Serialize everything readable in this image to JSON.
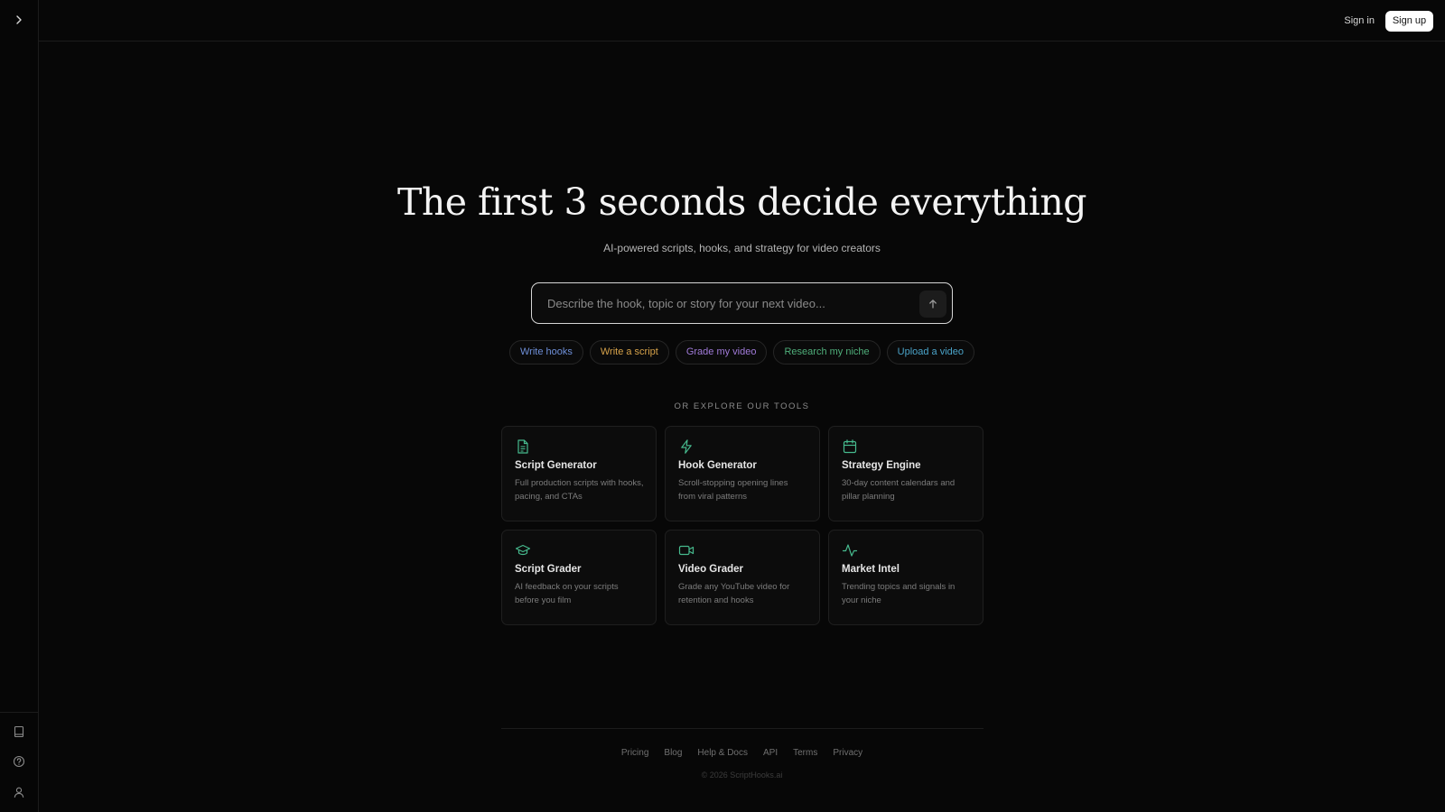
{
  "header": {
    "sign_in": "Sign in",
    "sign_up": "Sign up"
  },
  "hero": {
    "title": "The first 3 seconds decide everything",
    "subtitle": "AI-powered scripts, hooks, and strategy for video creators"
  },
  "prompt": {
    "placeholder": "Describe the hook, topic or story for your next video..."
  },
  "chips": [
    {
      "label": "Write hooks",
      "color": "#6e8fd8"
    },
    {
      "label": "Write a script",
      "color": "#d6a24a"
    },
    {
      "label": "Grade my video",
      "color": "#a07ad8"
    },
    {
      "label": "Research my niche",
      "color": "#4fae7a"
    },
    {
      "label": "Upload a video",
      "color": "#4aa3c8"
    }
  ],
  "explore_label": "OR EXPLORE OUR TOOLS",
  "tools": [
    {
      "title": "Script Generator",
      "desc": "Full production scripts with hooks, pacing, and CTAs",
      "icon": "document-icon",
      "color": "#46b98d"
    },
    {
      "title": "Hook Generator",
      "desc": "Scroll-stopping opening lines from viral patterns",
      "icon": "lightning-icon",
      "color": "#46b98d"
    },
    {
      "title": "Strategy Engine",
      "desc": "30-day content calendars and pillar planning",
      "icon": "calendar-icon",
      "color": "#46b98d"
    },
    {
      "title": "Script Grader",
      "desc": "AI feedback on your scripts before you film",
      "icon": "graduation-cap-icon",
      "color": "#46b98d"
    },
    {
      "title": "Video Grader",
      "desc": "Grade any YouTube video for retention and hooks",
      "icon": "video-camera-icon",
      "color": "#46b98d"
    },
    {
      "title": "Market Intel",
      "desc": "Trending topics and signals in your niche",
      "icon": "activity-icon",
      "color": "#46b98d"
    }
  ],
  "footer": {
    "links": [
      "Pricing",
      "Blog",
      "Help & Docs",
      "API",
      "Terms",
      "Privacy"
    ],
    "copyright": "© 2026 ScriptHooks.ai"
  },
  "sidebar": {
    "top_icon": "chevron-right-icon",
    "bottom_icons": [
      "book-icon",
      "help-circle-icon",
      "user-icon"
    ]
  }
}
